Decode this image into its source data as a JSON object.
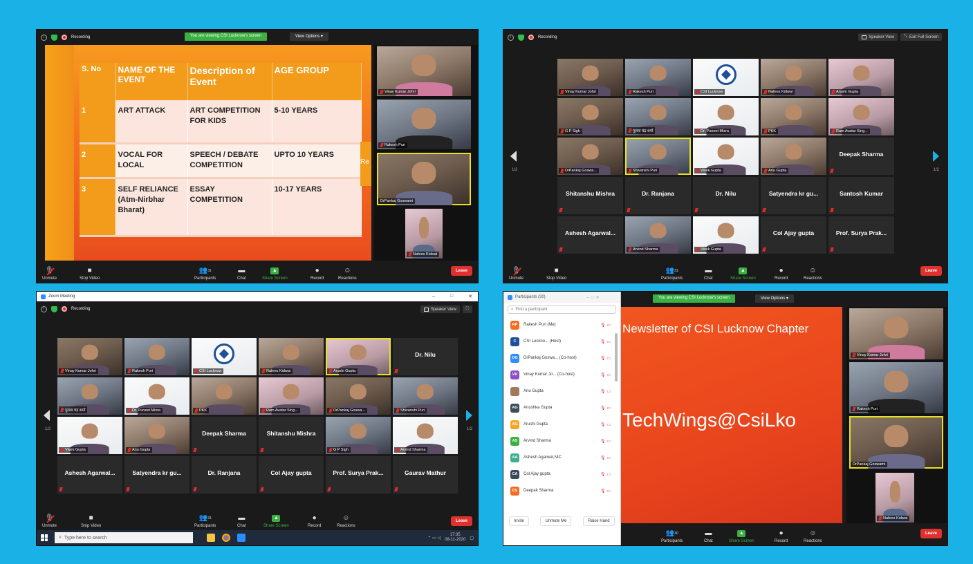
{
  "common": {
    "recording": "Recording",
    "viewing_banner": "You are viewing CSI Lucknow's screen",
    "view_options": "View Options",
    "speaker_view": "Speaker View",
    "exit_full_screen": "Exit Full Screen",
    "unmute": "Unmute",
    "stop_video": "Stop Video",
    "participants": "Participants",
    "chat": "Chat",
    "share_screen": "Share Screen",
    "record": "Record",
    "reactions": "Reactions",
    "leave": "Leave",
    "participant_count": "31",
    "participant_count_4": "30",
    "page": "1/2"
  },
  "shot1": {
    "headers": [
      "S. No",
      "NAME OF THE EVENT",
      "Description of Event",
      "AGE GROUP"
    ],
    "rows": [
      {
        "sno": "1",
        "name": "ART ATTACK",
        "desc": "ART COMPETITION FOR KIDS",
        "age": "5-10 YEARS"
      },
      {
        "sno": "2",
        "name": "VOCAL FOR LOCAL",
        "desc": "SPEECH / DEBATE COMPETITION",
        "age": "UPTO 10 YEARS"
      },
      {
        "sno": "3",
        "name": "SELF RELIANCE (Atm-Nirbhar Bharat)",
        "desc": "ESSAY COMPETITION",
        "age": "10-17 YEARS"
      }
    ],
    "cut_text": "Re",
    "strip": [
      "Vinay Kumar Johri",
      "Rakesh Puri",
      "DrPankaj Goswami",
      "Nafees Kidwai"
    ]
  },
  "shot2": {
    "tiles": [
      "Vinay Kumar Johri",
      "Rakesh Puri",
      "CSI Lucknow",
      "Nafees Kidwai",
      "Arushi Gupta",
      "G P Sigh",
      "गुलाब चंद्र शर्मा",
      "Dr. Puneet Misra",
      "PKK",
      "Ram Avatar Sing...",
      "DrPankaj Goswa...",
      "Shivanshi Puri",
      "Vivek Gupta",
      "Anu Gupta",
      "Deepak Sharma",
      "Shitanshu Mishra",
      "Dr. Ranjana",
      "Dr. Nilu",
      "Satyendra kr gu...",
      "Santosh Kumar",
      "Ashesh Agarwal...",
      "Arvind Sharma",
      "Vivek Gupta",
      "Col Ajay gupta",
      "Prof. Surya Prak..."
    ]
  },
  "shot3": {
    "window_title": "Zoom Meeting",
    "tiles": [
      "Vinay Kumar Johri",
      "Rakesh Puri",
      "CSI Lucknow",
      "Nafees Kidwai",
      "Arushi Gupta",
      "Dr. Nilu",
      "गुलाब चंद्र शर्मा",
      "Dr. Puneet Misra",
      "PKK",
      "Ram Avatar Sing...",
      "DrPankaj Goswa...",
      "Shivanshi Puri",
      "Vivek Gupta",
      "Anu Gupta",
      "Deepak Sharma",
      "Shitanshu Mishra",
      "G P Sigh",
      "Arvind Sharma",
      "Ashesh Agarwal...",
      "Satyendra kr gu...",
      "Dr. Ranjana",
      "Col Ajay gupta",
      "Prof. Surya Prak...",
      "Gaurav Mathur"
    ],
    "taskbar_search": "Type here to search",
    "time": "17:35",
    "date": "08-11-2020"
  },
  "shot4": {
    "panel_title": "Participants (30)",
    "find_placeholder": "Find a participant",
    "participants": [
      {
        "initials": "RP",
        "name": "Rakesh Puri (Me)",
        "color": "#f26d21"
      },
      {
        "initials": "C",
        "name": "CSI Luckno... (Host)",
        "color": "#1e4f9a"
      },
      {
        "initials": "DG",
        "name": "DrPankaj Goswa... (Co-host)",
        "color": "#2d8cff"
      },
      {
        "initials": "VK",
        "name": "Vinay Kumar Jo... (Co-host)",
        "color": "#8e4ec6"
      },
      {
        "initials": "",
        "name": "Anu Gupta",
        "color": "#a0785a"
      },
      {
        "initials": "AG",
        "name": "Anushka Gupta",
        "color": "#3a4a5c"
      },
      {
        "initials": "AG",
        "name": "Arushi Gupta",
        "color": "#f5a623"
      },
      {
        "initials": "AS",
        "name": "Arvind Sharma",
        "color": "#3cb043"
      },
      {
        "initials": "AA",
        "name": "Ashesh Agarwal,NIC",
        "color": "#3cb08f"
      },
      {
        "initials": "CA",
        "name": "Col Ajay gupta",
        "color": "#3a4a5c"
      },
      {
        "initials": "DS",
        "name": "Deepak Sharma",
        "color": "#f26d21"
      }
    ],
    "invite": "Invite",
    "unmute_me": "Unmute Me",
    "raise_hand": "Raise Hand",
    "slide_title": "Newsletter of CSI Lucknow Chapter",
    "slide_handle": "TechWings@CsiLko",
    "strip": [
      "Vinay Kumar Johri",
      "Rakesh Puri",
      "DrPankaj Goswami",
      "Nafees Kidwai"
    ]
  }
}
